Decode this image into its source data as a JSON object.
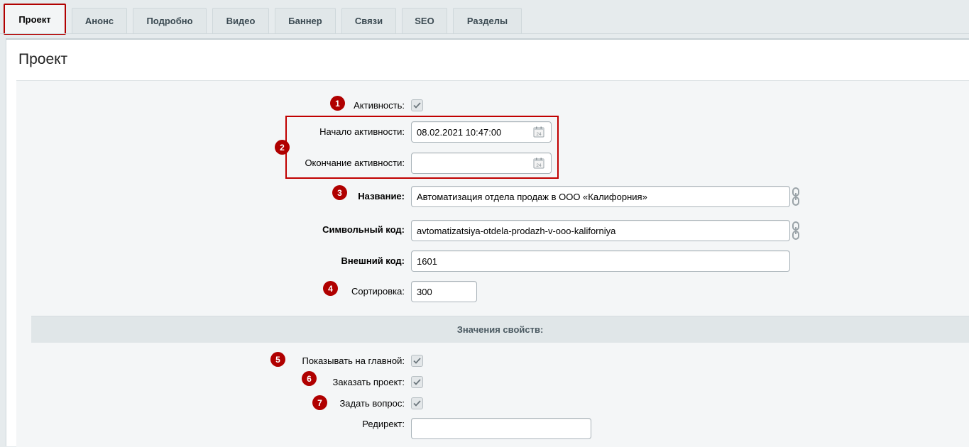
{
  "tabs": [
    {
      "label": "Проект",
      "active": true
    },
    {
      "label": "Анонс"
    },
    {
      "label": "Подробно"
    },
    {
      "label": "Видео"
    },
    {
      "label": "Баннер"
    },
    {
      "label": "Связи"
    },
    {
      "label": "SEO"
    },
    {
      "label": "Разделы"
    }
  ],
  "panel_title": "Проект",
  "form": {
    "active": {
      "label": "Активность:",
      "checked": true,
      "marker": "1"
    },
    "date_marker": "2",
    "active_from": {
      "label": "Начало активности:",
      "value": "08.02.2021 10:47:00"
    },
    "active_to": {
      "label": "Окончание активности:",
      "value": ""
    },
    "name": {
      "label": "Название:",
      "value": "Автоматизация отдела продаж в ООО «Калифорния»",
      "marker": "3"
    },
    "code": {
      "label": "Символьный код:",
      "value": "avtomatizatsiya-otdela-prodazh-v-ooo-kaliforniya"
    },
    "xml_id": {
      "label": "Внешний код:",
      "value": "1601"
    },
    "sort": {
      "label": "Сортировка:",
      "value": "300",
      "marker": "4"
    }
  },
  "properties": {
    "section_title": "Значения свойств:",
    "show_main": {
      "label": "Показывать на главной:",
      "checked": true,
      "marker": "5"
    },
    "order_project": {
      "label": "Заказать проект:",
      "checked": true,
      "marker": "6"
    },
    "ask_question": {
      "label": "Задать вопрос:",
      "checked": true,
      "marker": "7"
    },
    "redirect": {
      "label": "Редирект:",
      "value": ""
    }
  },
  "calendar_icon_text": "24",
  "icons": {
    "calendar": "calendar-icon",
    "link": "chain-link-icon",
    "check": "checkmark-icon"
  },
  "colors": {
    "highlight": "#c00000",
    "marker": "#b00000"
  }
}
